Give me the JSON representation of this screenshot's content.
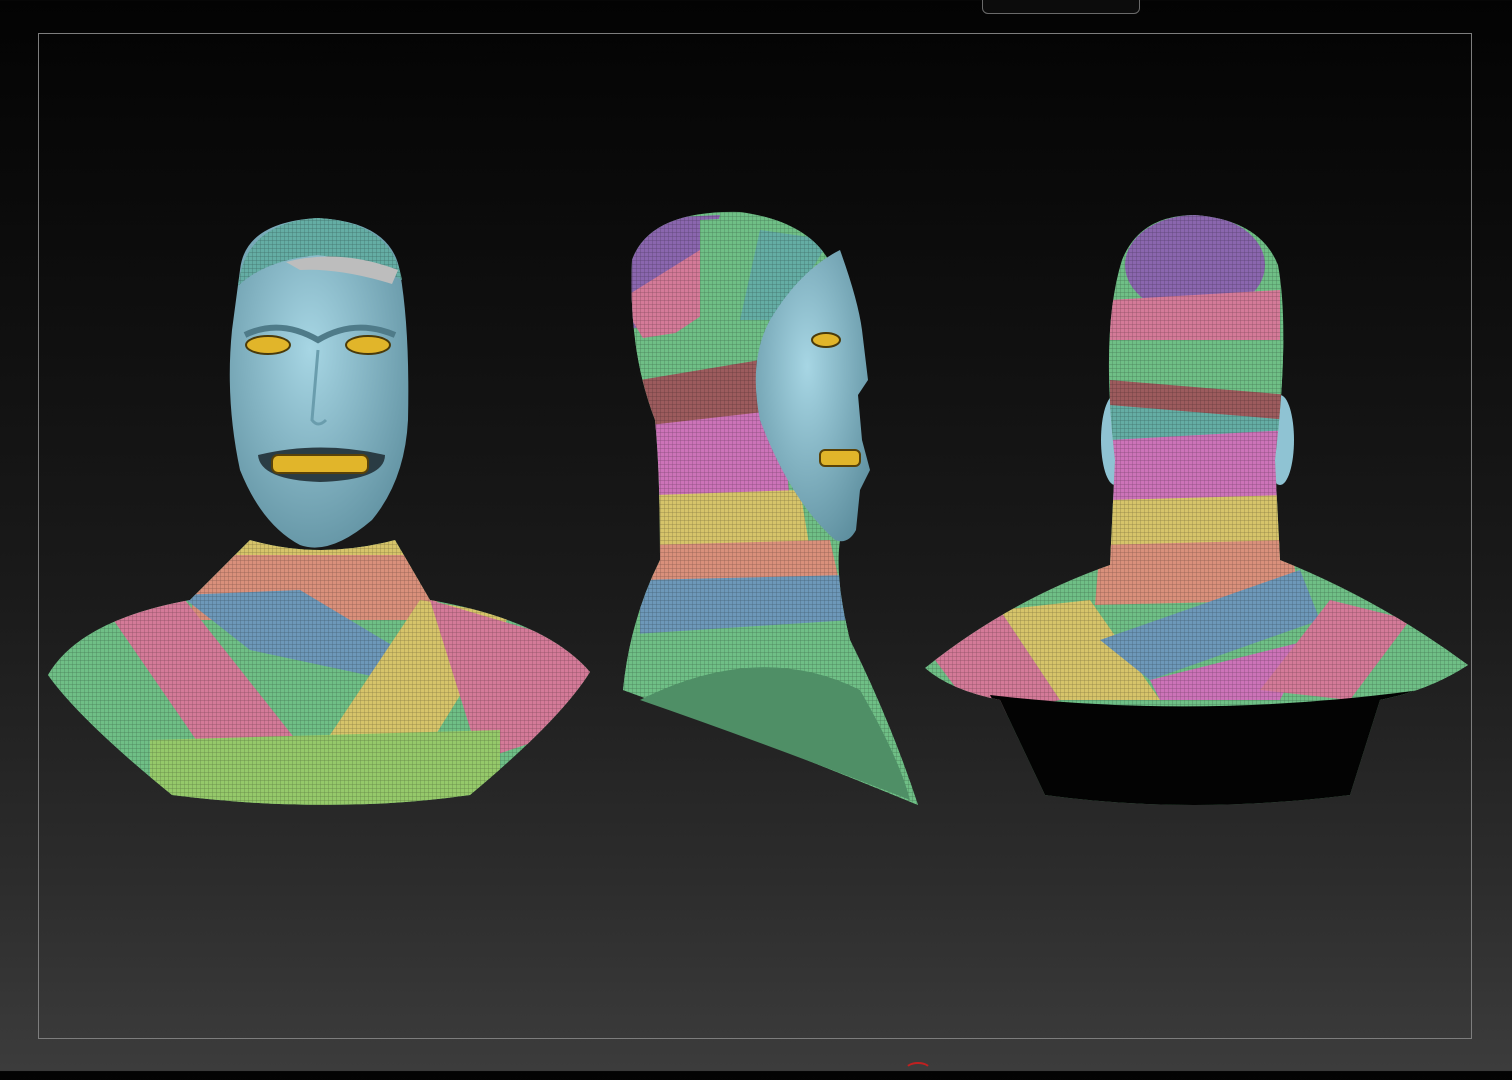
{
  "viewport": {
    "background_top": "#030303",
    "background_bottom": "#3c3c3c",
    "frame_color": "#7d7d7d"
  },
  "polygroup_colors": {
    "skin": "#8fc3d3",
    "eyes_teeth": "#e1b52a",
    "green": "#6fbf86",
    "lime": "#95c96a",
    "pink": "#d47a98",
    "magenta": "#cc73b8",
    "salmon": "#d9907b",
    "blue": "#6d98b9",
    "yellow": "#d6c46a",
    "purple": "#8a66ae",
    "teal": "#64ada4",
    "maroon": "#9c5b5d"
  },
  "models": [
    {
      "id": "front",
      "icon": "bust-front-view"
    },
    {
      "id": "side",
      "icon": "bust-side-view"
    },
    {
      "id": "back",
      "icon": "bust-back-view"
    }
  ]
}
